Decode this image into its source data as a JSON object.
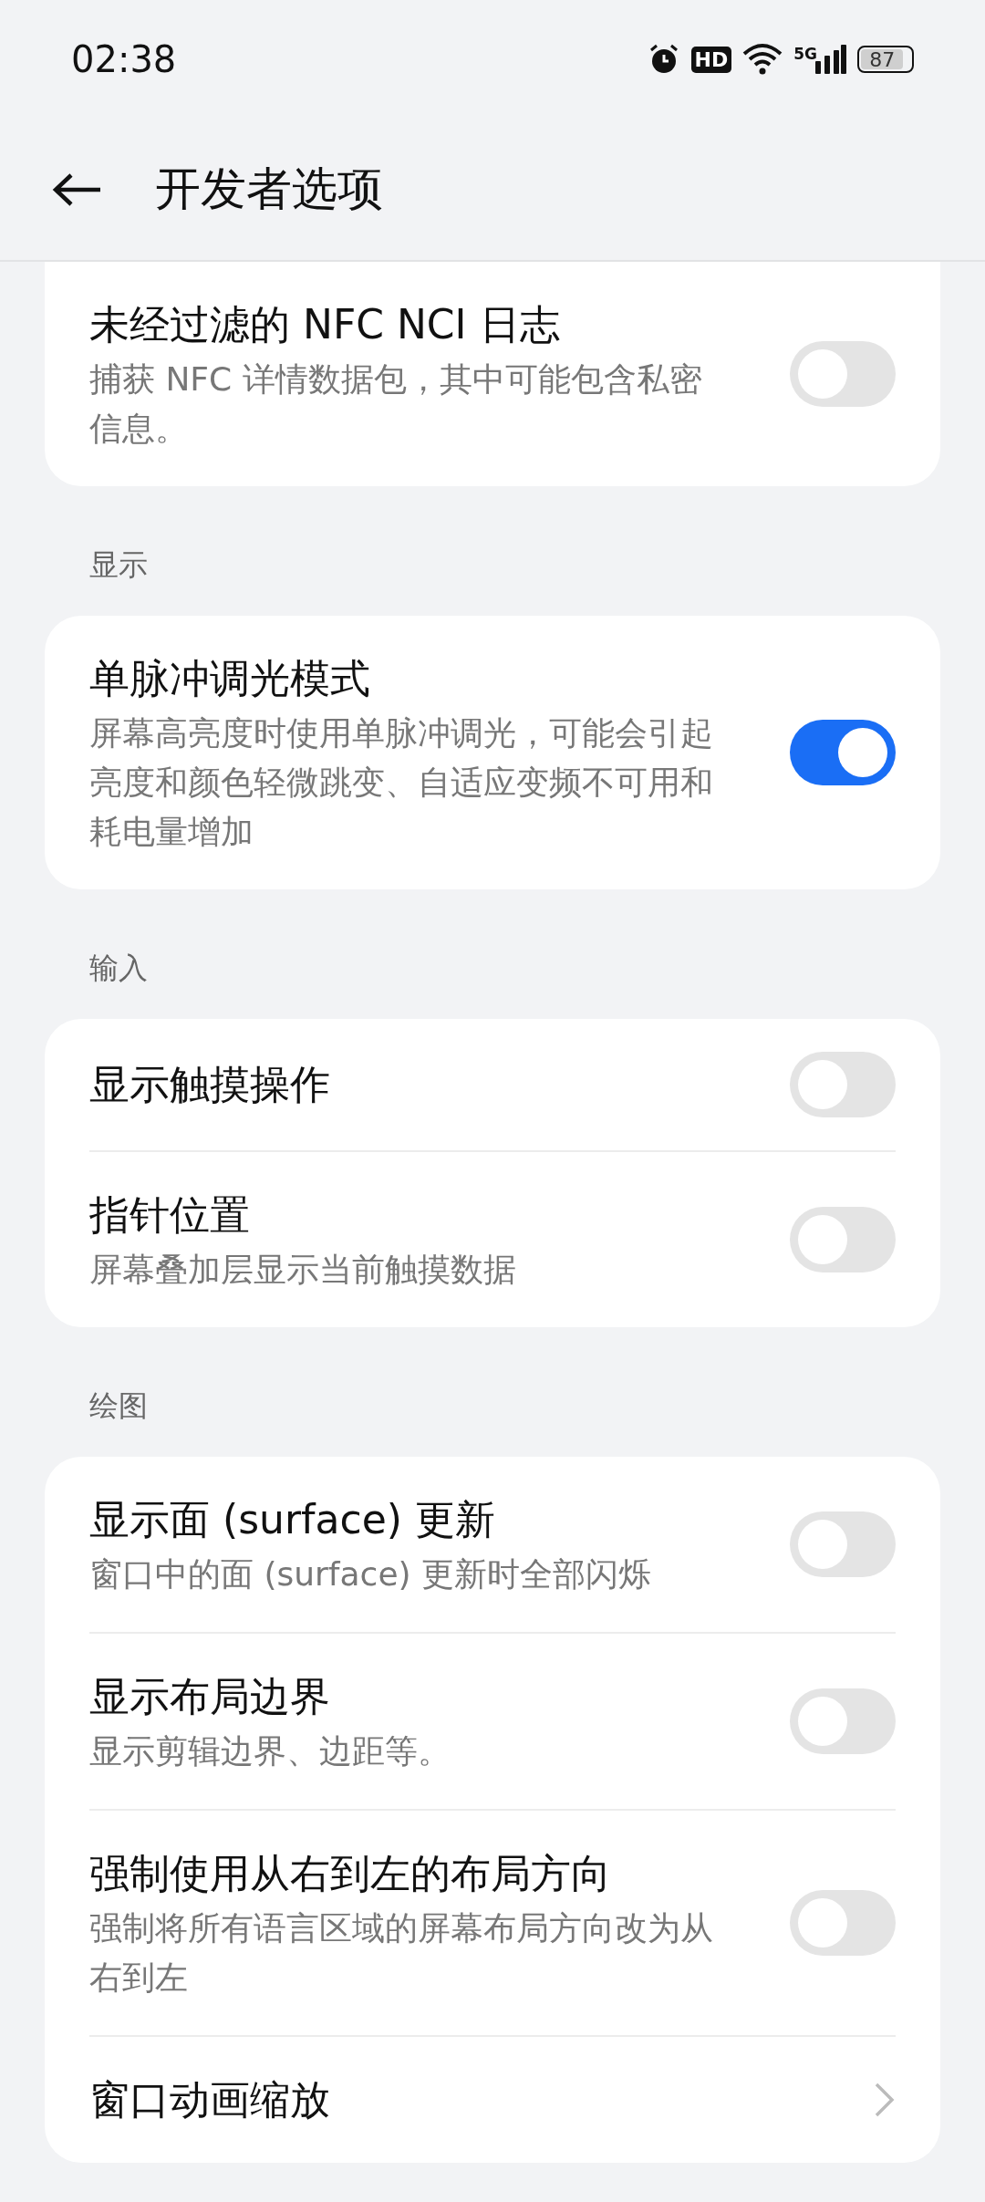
{
  "status_bar": {
    "time": "02:38",
    "hd": "HD",
    "network": "5G",
    "battery": "87"
  },
  "header": {
    "title": "开发者选项"
  },
  "sections": [
    {
      "items": [
        {
          "kind": "switch",
          "title": "未经过滤的 NFC NCI 日志",
          "subtitle": "捕获 NFC 详情数据包，其中可能包含私密信息。",
          "on": false
        }
      ]
    },
    {
      "label": "显示",
      "items": [
        {
          "kind": "switch",
          "title": "单脉冲调光模式",
          "subtitle": "屏幕高亮度时使用单脉冲调光，可能会引起亮度和颜色轻微跳变、自适应变频不可用和耗电量增加",
          "on": true
        }
      ]
    },
    {
      "label": "输入",
      "items": [
        {
          "kind": "switch",
          "title": "显示触摸操作",
          "on": false
        },
        {
          "kind": "switch",
          "title": "指针位置",
          "subtitle": "屏幕叠加层显示当前触摸数据",
          "on": false
        }
      ]
    },
    {
      "label": "绘图",
      "items": [
        {
          "kind": "switch",
          "title": "显示面 (surface) 更新",
          "subtitle": "窗口中的面 (surface) 更新时全部闪烁",
          "on": false
        },
        {
          "kind": "switch",
          "title": "显示布局边界",
          "subtitle": "显示剪辑边界、边距等。",
          "on": false
        },
        {
          "kind": "switch",
          "title": "强制使用从右到左的布局方向",
          "subtitle": "强制将所有语言区域的屏幕布局方向改为从右到左",
          "on": false
        },
        {
          "kind": "link",
          "title": "窗口动画缩放"
        }
      ]
    }
  ]
}
